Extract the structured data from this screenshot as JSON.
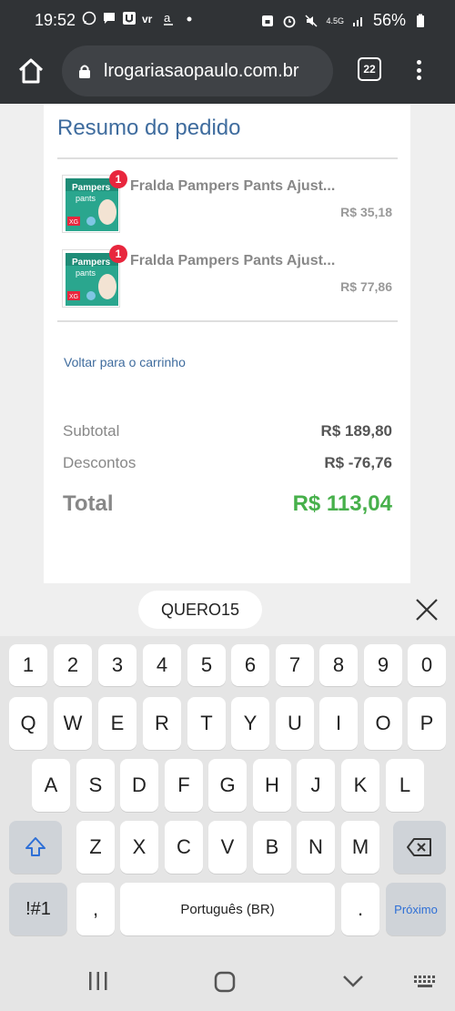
{
  "status_bar": {
    "time": "19:52",
    "battery": "56%",
    "network": "4.5G"
  },
  "browser": {
    "url": "lrogariasaopaulo.com.br",
    "tab_count": "22"
  },
  "order": {
    "title": "Resumo do pedido",
    "items": [
      {
        "name": "Fralda Pampers Pants Ajust...",
        "price": "R$ 35,18",
        "qty": "1"
      },
      {
        "name": "Fralda Pampers Pants Ajust...",
        "price": "R$ 77,86",
        "qty": "1"
      }
    ],
    "back_link": "Voltar para o carrinho",
    "subtotal_label": "Subtotal",
    "subtotal_value": "R$ 189,80",
    "discount_label": "Descontos",
    "discount_value": "R$ -76,76",
    "total_label": "Total",
    "total_value": "R$ 113,04"
  },
  "keyboard": {
    "suggestion": "QUERO15",
    "row_numbers": [
      "1",
      "2",
      "3",
      "4",
      "5",
      "6",
      "7",
      "8",
      "9",
      "0"
    ],
    "row_1": [
      "Q",
      "W",
      "E",
      "R",
      "T",
      "Y",
      "U",
      "I",
      "O",
      "P"
    ],
    "row_2": [
      "A",
      "S",
      "D",
      "F",
      "G",
      "H",
      "J",
      "K",
      "L"
    ],
    "row_3": [
      "Z",
      "X",
      "C",
      "V",
      "B",
      "N",
      "M"
    ],
    "symbols_key": "!#1",
    "comma_key": ",",
    "space_label": "Português (BR)",
    "period_key": ".",
    "next_key": "Próximo"
  },
  "colors": {
    "accent_blue": "#3f6c9e",
    "total_green": "#47b04b",
    "badge_red": "#e8263d"
  }
}
